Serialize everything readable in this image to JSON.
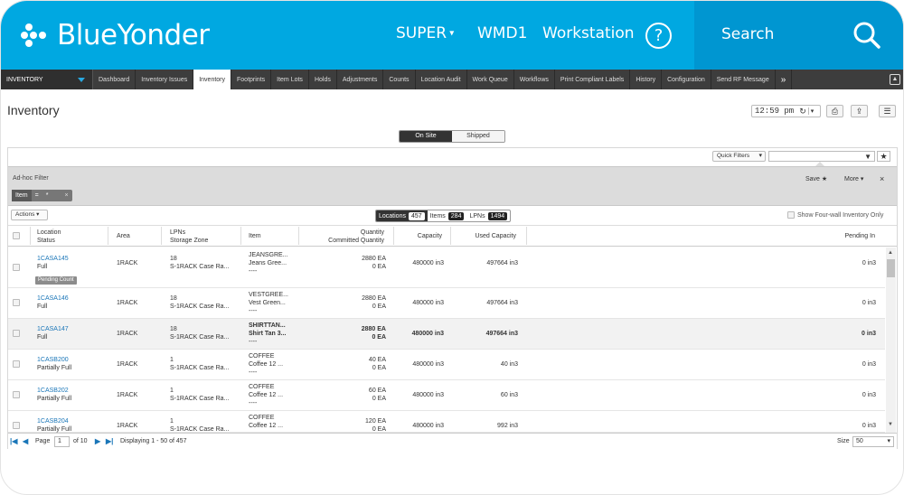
{
  "header": {
    "brand": "BlueYonder",
    "user": "SUPER",
    "warehouse": "WMD1",
    "workstation": "Workstation",
    "help_icon": "?",
    "search_label": "Search"
  },
  "tabs": {
    "module": "INVENTORY",
    "items": [
      "Dashboard",
      "Inventory Issues",
      "Inventory",
      "Footprints",
      "Item Lots",
      "Holds",
      "Adjustments",
      "Counts",
      "Location Audit",
      "Work Queue",
      "Workflows",
      "Print Compliant Labels",
      "History",
      "Configuration",
      "Send RF Message"
    ],
    "active": "Inventory",
    "more": "»"
  },
  "page": {
    "title": "Inventory",
    "time": "12:59 pm"
  },
  "view_toggle": {
    "on": "On Site",
    "off": "Shipped"
  },
  "filters": {
    "quick_filters": "Quick Filters",
    "adhoc_label": "Ad-hoc Filter",
    "pill": {
      "field": "Item",
      "op": "=",
      "value": "*",
      "remove": "×"
    },
    "save": "Save ★",
    "more": "More ▾",
    "close": "×"
  },
  "toolbar": {
    "actions": "Actions",
    "segments": [
      {
        "label": "Locations",
        "count": "457"
      },
      {
        "label": "Items",
        "count": "284"
      },
      {
        "label": "LPNs",
        "count": "1494"
      }
    ],
    "four_wall": "Show Four-wall Inventory Only"
  },
  "columns": {
    "location": "Location",
    "status": "Status",
    "area": "Area",
    "lpns": "LPNs",
    "storage_zone": "Storage Zone",
    "item": "Item",
    "quantity": "Quantity",
    "committed": "Committed Quantity",
    "capacity": "Capacity",
    "used_capacity": "Used Capacity",
    "pending_in": "Pending In"
  },
  "rows": [
    {
      "location": "1CASA145",
      "status": "Full",
      "area": "1RACK",
      "lpns": "18",
      "zone": "S-1RACK Case Ra...",
      "item1": "JEANSGRE...",
      "item2": "Jeans Gree...",
      "item3": "----",
      "qty": "2880 EA",
      "committed": "0 EA",
      "capacity": "480000 in3",
      "used": "497664 in3",
      "pending": "0 in3",
      "badge": "Pending Count"
    },
    {
      "location": "1CASA146",
      "status": "Full",
      "area": "1RACK",
      "lpns": "18",
      "zone": "S-1RACK Case Ra...",
      "item1": "VESTGREE...",
      "item2": "Vest Green...",
      "item3": "----",
      "qty": "2880 EA",
      "committed": "0 EA",
      "capacity": "480000 in3",
      "used": "497664 in3",
      "pending": "0 in3"
    },
    {
      "location": "1CASA147",
      "status": "Full",
      "area": "1RACK",
      "lpns": "18",
      "zone": "S-1RACK Case Ra...",
      "item1": "SHIRTTAN...",
      "item2": "Shirt Tan 3...",
      "item3": "----",
      "qty": "2880 EA",
      "committed": "0 EA",
      "capacity": "480000 in3",
      "used": "497664 in3",
      "pending": "0 in3"
    },
    {
      "location": "1CASB200",
      "status": "Partially Full",
      "area": "1RACK",
      "lpns": "1",
      "zone": "S-1RACK Case Ra...",
      "item1": "COFFEE",
      "item2": "Coffee 12 ...",
      "item3": "----",
      "qty": "40 EA",
      "committed": "0 EA",
      "capacity": "480000 in3",
      "used": "40 in3",
      "pending": "0 in3"
    },
    {
      "location": "1CASB202",
      "status": "Partially Full",
      "area": "1RACK",
      "lpns": "1",
      "zone": "S-1RACK Case Ra...",
      "item1": "COFFEE",
      "item2": "Coffee 12 ...",
      "item3": "----",
      "qty": "60 EA",
      "committed": "0 EA",
      "capacity": "480000 in3",
      "used": "60 in3",
      "pending": "0 in3"
    },
    {
      "location": "1CASB204",
      "status": "Partially Full",
      "area": "1RACK",
      "lpns": "1",
      "zone": "S-1RACK Case Ra...",
      "item1": "COFFEE",
      "item2": "Coffee 12 ...",
      "item3": "----",
      "qty": "120 EA",
      "committed": "0 EA",
      "capacity": "480000 in3",
      "used": "992 in3",
      "pending": "0 in3"
    }
  ],
  "pager": {
    "page_label": "Page",
    "page": "1",
    "of": "of 10",
    "displaying": "Displaying 1 - 50 of 457",
    "size_label": "Size",
    "size": "50"
  },
  "colors": {
    "brand": "#00a8e1",
    "search_bg": "#0096d1",
    "tabbar": "#3d3d3d",
    "link": "#1a76b8"
  }
}
